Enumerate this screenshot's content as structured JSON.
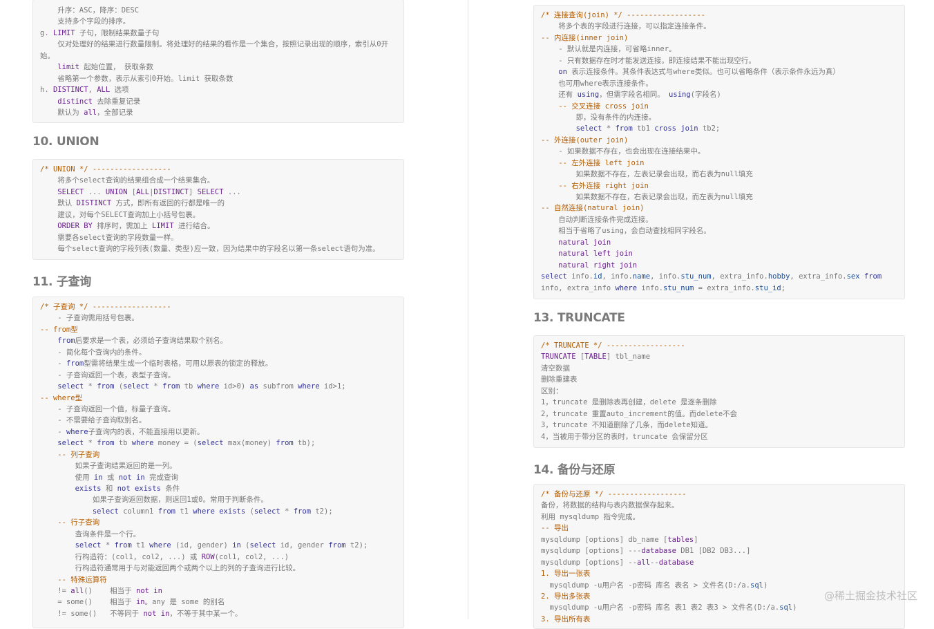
{
  "sections": {
    "union": {
      "heading": "10. UNION"
    },
    "subquery": {
      "heading": "11. 子查询"
    },
    "truncate": {
      "heading": "13. TRUNCATE"
    },
    "backup": {
      "heading": "14. 备份与还原"
    }
  },
  "watermark": "@稀土掘金技术社区",
  "code_blocks": {
    "select_cont": [
      [
        [
          "    升序：ASC，降序：DESC",
          "t"
        ]
      ],
      [
        [
          "    支持多个字段的排序。",
          "t"
        ]
      ],
      [
        [
          "g. ",
          "t"
        ],
        [
          "LIMIT",
          "mk"
        ],
        [
          " 子句，限制结果数量子句",
          "t"
        ]
      ],
      [
        [
          "    仅对处理好的结果进行数量限制。将处理好的结果的看作是一个集合，按照记录出现的顺序，索引从0开",
          "t"
        ]
      ],
      [
        [
          "始。",
          "t"
        ]
      ],
      [
        [
          "    ",
          "t"
        ],
        [
          "limit",
          "mk"
        ],
        [
          " 起始位置， 获取条数",
          "t"
        ]
      ],
      [
        [
          "    省略第一个参数，表示从索引0开始。limit 获取条数",
          "t"
        ]
      ],
      [
        [
          "h. ",
          "t"
        ],
        [
          "DISTINCT",
          "mk"
        ],
        [
          ", ",
          "t"
        ],
        [
          "ALL",
          "mk"
        ],
        [
          " 选项",
          "t"
        ]
      ],
      [
        [
          "    ",
          "t"
        ],
        [
          "distinct",
          "mk"
        ],
        [
          " 去除重复记录",
          "t"
        ]
      ],
      [
        [
          "    默认为 ",
          "t"
        ],
        [
          "all",
          "mk"
        ],
        [
          "，全部记录",
          "t"
        ]
      ]
    ],
    "union": [
      [
        [
          "/* UNION */ ------------------",
          "cm"
        ]
      ],
      [
        [
          "    将多个select查询的结果组合成一个结果集合。",
          "t"
        ]
      ],
      [
        [
          "    ",
          "t"
        ],
        [
          "SELECT",
          "mk"
        ],
        [
          " ... ",
          "t"
        ],
        [
          "UNION",
          "mk"
        ],
        [
          " [",
          "t"
        ],
        [
          "ALL",
          "mk"
        ],
        [
          "|",
          "t"
        ],
        [
          "DISTINCT",
          "mk"
        ],
        [
          "] ",
          "t"
        ],
        [
          "SELECT",
          "mk"
        ],
        [
          " ...",
          "t"
        ]
      ],
      [
        [
          "    默认 ",
          "t"
        ],
        [
          "DISTINCT",
          "mk"
        ],
        [
          " 方式，即所有返回的行都是唯一的",
          "t"
        ]
      ],
      [
        [
          "    建议，对每个SELECT查询加上小括号包裹。",
          "t"
        ]
      ],
      [
        [
          "    ",
          "t"
        ],
        [
          "ORDER BY",
          "mk"
        ],
        [
          " 排序时，需加上 ",
          "t"
        ],
        [
          "LIMIT",
          "mk"
        ],
        [
          " 进行结合。",
          "t"
        ]
      ],
      [
        [
          "    需要各select查询的字段数量一样。",
          "t"
        ]
      ],
      [
        [
          "    每个select查询的字段列表(数量、类型)应一致，因为结果中的字段名以第一条select语句为准。",
          "t"
        ]
      ]
    ],
    "subquery": [
      [
        [
          "/* 子查询 */ ------------------",
          "cm"
        ]
      ],
      [
        [
          "    - 子查询需用括号包裹。",
          "t"
        ]
      ],
      [
        [
          "-- from型",
          "cm"
        ]
      ],
      [
        [
          "    ",
          "t"
        ],
        [
          "from",
          "kw"
        ],
        [
          "后要求是一个表，必须给子查询结果取个别名。",
          "t"
        ]
      ],
      [
        [
          "    - 简化每个查询内的条件。",
          "t"
        ]
      ],
      [
        [
          "    - ",
          "t"
        ],
        [
          "from",
          "kw"
        ],
        [
          "型需将结果生成一个临时表格，可用以原表的锁定的释放。",
          "t"
        ]
      ],
      [
        [
          "    - 子查询返回一个表，表型子查询。",
          "t"
        ]
      ],
      [
        [
          "    ",
          "t"
        ],
        [
          "select",
          "kw"
        ],
        [
          " * ",
          "t"
        ],
        [
          "from",
          "kw"
        ],
        [
          " (",
          "t"
        ],
        [
          "select",
          "kw"
        ],
        [
          " * ",
          "t"
        ],
        [
          "from",
          "kw"
        ],
        [
          " tb ",
          "t"
        ],
        [
          "where",
          "kw"
        ],
        [
          " id>0) ",
          "t"
        ],
        [
          "as",
          "kw"
        ],
        [
          " subfrom ",
          "t"
        ],
        [
          "where",
          "kw"
        ],
        [
          " id>1;",
          "t"
        ]
      ],
      [
        [
          "-- where型",
          "cm"
        ]
      ],
      [
        [
          "    - 子查询返回一个值，标量子查询。",
          "t"
        ]
      ],
      [
        [
          "    - 不需要给子查询取别名。",
          "t"
        ]
      ],
      [
        [
          "    - ",
          "t"
        ],
        [
          "where",
          "kw"
        ],
        [
          "子查询内的表，不能直接用以更新。",
          "t"
        ]
      ],
      [
        [
          "    ",
          "t"
        ],
        [
          "select",
          "kw"
        ],
        [
          " * ",
          "t"
        ],
        [
          "from",
          "kw"
        ],
        [
          " tb ",
          "t"
        ],
        [
          "where",
          "kw"
        ],
        [
          " money = (",
          "t"
        ],
        [
          "select",
          "kw"
        ],
        [
          " max(money) ",
          "t"
        ],
        [
          "from",
          "kw"
        ],
        [
          " tb);",
          "t"
        ]
      ],
      [
        [
          "    -- 列子查询",
          "cm"
        ]
      ],
      [
        [
          "        如果子查询结果返回的是一列。",
          "t"
        ]
      ],
      [
        [
          "        使用 ",
          "t"
        ],
        [
          "in",
          "kw"
        ],
        [
          " 或 ",
          "t"
        ],
        [
          "not in",
          "kw"
        ],
        [
          " 完成查询",
          "t"
        ]
      ],
      [
        [
          "        ",
          "t"
        ],
        [
          "exists",
          "kw"
        ],
        [
          " 和 ",
          "t"
        ],
        [
          "not exists",
          "kw"
        ],
        [
          " 条件",
          "t"
        ]
      ],
      [
        [
          "            如果子查询返回数据，则返回1或0。常用于判断条件。",
          "t"
        ]
      ],
      [
        [
          "            ",
          "t"
        ],
        [
          "select",
          "kw"
        ],
        [
          " column1 ",
          "t"
        ],
        [
          "from",
          "kw"
        ],
        [
          " t1 ",
          "t"
        ],
        [
          "where",
          "kw"
        ],
        [
          " ",
          "t"
        ],
        [
          "exists",
          "kw"
        ],
        [
          " (",
          "t"
        ],
        [
          "select",
          "kw"
        ],
        [
          " * ",
          "t"
        ],
        [
          "from",
          "kw"
        ],
        [
          " t2);",
          "t"
        ]
      ],
      [
        [
          "    -- 行子查询",
          "cm"
        ]
      ],
      [
        [
          "        查询条件是一个行。",
          "t"
        ]
      ],
      [
        [
          "        ",
          "t"
        ],
        [
          "select",
          "kw"
        ],
        [
          " * ",
          "t"
        ],
        [
          "from",
          "kw"
        ],
        [
          " t1 ",
          "t"
        ],
        [
          "where",
          "kw"
        ],
        [
          " (id, gender) ",
          "t"
        ],
        [
          "in",
          "kw"
        ],
        [
          " (",
          "t"
        ],
        [
          "select",
          "kw"
        ],
        [
          " id, gender ",
          "t"
        ],
        [
          "from",
          "kw"
        ],
        [
          " t2);",
          "t"
        ]
      ],
      [
        [
          "        行构造符：(col1, col2, ...) 或 ",
          "t"
        ],
        [
          "ROW",
          "mk"
        ],
        [
          "(col1, col2, ...)",
          "t"
        ]
      ],
      [
        [
          "        行构造符通常用于与对能返回两个或两个以上的列的子查询进行比较。",
          "t"
        ]
      ],
      [
        [
          "    -- 特殊运算符",
          "cm"
        ]
      ],
      [
        [
          "    != ",
          "t"
        ],
        [
          "all",
          "mk"
        ],
        [
          "()    相当于 ",
          "t"
        ],
        [
          "not in",
          "mk"
        ]
      ],
      [
        [
          "    = some()    相当于 ",
          "t"
        ],
        [
          "in",
          "mk"
        ],
        [
          "。any 是 some 的别名",
          "t"
        ]
      ],
      [
        [
          "    != some()   不等同于 ",
          "t"
        ],
        [
          "not in",
          "mk"
        ],
        [
          "，不等于其中某一个。",
          "t"
        ]
      ]
    ],
    "join": [
      [
        [
          "/* 连接查询(join) */ ------------------",
          "cm"
        ]
      ],
      [
        [
          "    将多个表的字段进行连接，可以指定连接条件。",
          "t"
        ]
      ],
      [
        [
          "-- 内连接(inner join)",
          "cm"
        ]
      ],
      [
        [
          "    - 默认就是内连接，可省略inner。",
          "t"
        ]
      ],
      [
        [
          "    - 只有数据存在时才能发送连接。即连接结果不能出现空行。",
          "t"
        ]
      ],
      [
        [
          "    ",
          "t"
        ],
        [
          "on",
          "kw"
        ],
        [
          " 表示连接条件。其条件表达式与where类似。也可以省略条件（表示条件永远为真）",
          "t"
        ]
      ],
      [
        [
          "    也可用where表示连接条件。",
          "t"
        ]
      ],
      [
        [
          "    还有 ",
          "t"
        ],
        [
          "using",
          "kw"
        ],
        [
          "，但需字段名相同。 ",
          "t"
        ],
        [
          "using",
          "kw"
        ],
        [
          "(字段名)",
          "t"
        ]
      ],
      [
        [
          "    -- 交叉连接 cross join",
          "cm"
        ]
      ],
      [
        [
          "        即，没有条件的内连接。",
          "t"
        ]
      ],
      [
        [
          "        ",
          "t"
        ],
        [
          "select",
          "kw"
        ],
        [
          " * ",
          "t"
        ],
        [
          "from",
          "kw"
        ],
        [
          " tb1 ",
          "t"
        ],
        [
          "cross join",
          "kw"
        ],
        [
          " tb2;",
          "t"
        ]
      ],
      [
        [
          "-- 外连接(outer join)",
          "cm"
        ]
      ],
      [
        [
          "    - 如果数据不存在，也会出现在连接结果中。",
          "t"
        ]
      ],
      [
        [
          "    -- 左外连接 left join",
          "cm"
        ]
      ],
      [
        [
          "        如果数据不存在，左表记录会出现，而右表为null填充",
          "t"
        ]
      ],
      [
        [
          "    -- 右外连接 right join",
          "cm"
        ]
      ],
      [
        [
          "        如果数据不存在，右表记录会出现，而左表为null填充",
          "t"
        ]
      ],
      [
        [
          "-- 自然连接(natural join)",
          "cm"
        ]
      ],
      [
        [
          "    自动判断连接条件完成连接。",
          "t"
        ]
      ],
      [
        [
          "    相当于省略了using，会自动查找相同字段名。",
          "t"
        ]
      ],
      [
        [
          "    ",
          "t"
        ],
        [
          "natural join",
          "mk"
        ]
      ],
      [
        [
          "    ",
          "t"
        ],
        [
          "natural left join",
          "mk"
        ]
      ],
      [
        [
          "    ",
          "t"
        ],
        [
          "natural right join",
          "mk"
        ]
      ],
      [
        [
          "select",
          "kw"
        ],
        [
          " info.",
          "t"
        ],
        [
          "id",
          "ac"
        ],
        [
          ", info.",
          "t"
        ],
        [
          "name",
          "ac"
        ],
        [
          ", info.",
          "t"
        ],
        [
          "stu_num",
          "ac"
        ],
        [
          ", extra_info.",
          "t"
        ],
        [
          "hobby",
          "ac"
        ],
        [
          ", extra_info.",
          "t"
        ],
        [
          "sex",
          "ac"
        ],
        [
          " ",
          "t"
        ],
        [
          "from",
          "kw"
        ]
      ],
      [
        [
          "info, extra_info ",
          "t"
        ],
        [
          "where",
          "kw"
        ],
        [
          " info.",
          "t"
        ],
        [
          "stu_num",
          "ac"
        ],
        [
          " = extra_info.",
          "t"
        ],
        [
          "stu_id",
          "ac"
        ],
        [
          ";",
          "t"
        ]
      ]
    ],
    "truncate": [
      [
        [
          "/* TRUNCATE */ ------------------",
          "cm"
        ]
      ],
      [
        [
          "TRUNCATE",
          "mk"
        ],
        [
          " [",
          "t"
        ],
        [
          "TABLE",
          "mk"
        ],
        [
          "] tbl_name",
          "t"
        ]
      ],
      [
        [
          "清空数据",
          "t"
        ]
      ],
      [
        [
          "删除重建表",
          "t"
        ]
      ],
      [
        [
          "区别：",
          "t"
        ]
      ],
      [
        [
          "1，truncate 是删除表再创建，delete 是逐条删除",
          "t"
        ]
      ],
      [
        [
          "2，truncate 重置auto_increment的值。而delete不会",
          "t"
        ]
      ],
      [
        [
          "3，truncate 不知道删除了几条，而delete知道。",
          "t"
        ]
      ],
      [
        [
          "4，当被用于带分区的表时，truncate 会保留分区",
          "t"
        ]
      ]
    ],
    "backup": [
      [
        [
          "/* 备份与还原 */ ------------------",
          "cm"
        ]
      ],
      [
        [
          "备份，将数据的结构与表内数据保存起来。",
          "t"
        ]
      ],
      [
        [
          "利用 mysqldump 指令完成。",
          "t"
        ]
      ],
      [
        [
          "-- 导出",
          "cm"
        ]
      ],
      [
        [
          "mysqldump [options] db_name [",
          "t"
        ],
        [
          "tables",
          "mk"
        ],
        [
          "]",
          "t"
        ]
      ],
      [
        [
          "mysqldump [options] ---",
          "t"
        ],
        [
          "database",
          "mk"
        ],
        [
          " DB1 [DB2 DB3...]",
          "t"
        ]
      ],
      [
        [
          "mysqldump [options] --",
          "t"
        ],
        [
          "all",
          "mk"
        ],
        [
          "--",
          "t"
        ],
        [
          "database",
          "mk"
        ]
      ],
      [
        [
          "1. 导出一张表",
          "cm"
        ]
      ],
      [
        [
          "  mysqldump -u用户名 -p密码 库名 表名 > 文件名(D:/a.",
          "t"
        ],
        [
          "sql",
          "ac"
        ],
        [
          ")",
          "t"
        ]
      ],
      [
        [
          "2. 导出多张表",
          "cm"
        ]
      ],
      [
        [
          "  mysqldump -u用户名 -p密码 库名 表1 表2 表3 > 文件名(D:/a.",
          "t"
        ],
        [
          "sql",
          "ac"
        ],
        [
          ")",
          "t"
        ]
      ],
      [
        [
          "3. 导出所有表",
          "cm"
        ]
      ]
    ]
  },
  "colors": {
    "keyword": "#333399",
    "comment": "#b35c00",
    "sql_keyword": "#6b1e8f",
    "field": "#1a4f9c",
    "text": "#777777"
  }
}
